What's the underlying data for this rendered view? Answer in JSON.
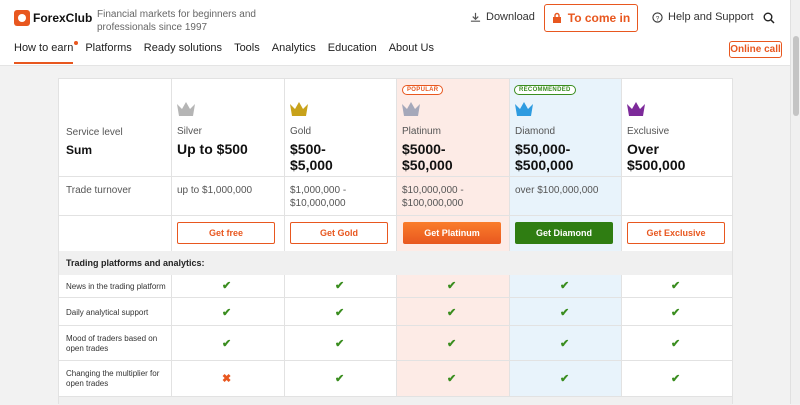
{
  "header": {
    "logo_text": "ForexClub",
    "tagline": "Financial markets for beginners and professionals since 1997",
    "download": "Download",
    "come_in": "To come in",
    "help": "Help and Support",
    "online_call": "Online call"
  },
  "nav": [
    "How to earn",
    "Platforms",
    "Ready solutions",
    "Tools",
    "Analytics",
    "Education",
    "About Us"
  ],
  "table": {
    "row_labels": {
      "service_level": "Service level",
      "sum": "Sum",
      "turnover": "Trade turnover"
    },
    "tiers": [
      {
        "name": "Silver",
        "sum": "Up to $500",
        "turnover": "up to $1,000,000",
        "button": "Get free",
        "crown_color": "#b5b5b5"
      },
      {
        "name": "Gold",
        "sum": "$500-\n$5,000",
        "turnover": "$1,000,000 -\n$10,000,000",
        "button": "Get Gold",
        "crown_color": "#c8a21a"
      },
      {
        "name": "Platinum",
        "sum": "$5000-\n$50,000",
        "turnover": "$10,000,000 -\n$100,000,000",
        "button": "Get Platinum",
        "crown_color": "#a5a8ba",
        "badge": "POPULAR"
      },
      {
        "name": "Diamond",
        "sum": "$50,000-\n$500,000",
        "turnover": "over $100,000,000",
        "button": "Get Diamond",
        "crown_color": "#2e9be0",
        "badge": "RECOMMENDED"
      },
      {
        "name": "Exclusive",
        "sum": "Over\n$500,000",
        "turnover": "",
        "button": "Get Exclusive",
        "crown_color": "#7d2a9a"
      }
    ],
    "section_title": "Trading platforms and analytics:",
    "features": [
      {
        "label": "News in the trading platform",
        "marks": [
          true,
          true,
          true,
          true,
          true
        ]
      },
      {
        "label": "Daily analytical support",
        "marks": [
          true,
          true,
          true,
          true,
          true
        ]
      },
      {
        "label": "Mood of traders based on open trades",
        "marks": [
          true,
          true,
          true,
          true,
          true
        ]
      },
      {
        "label": "Changing the multiplier for open trades",
        "marks": [
          false,
          true,
          true,
          true,
          true
        ]
      }
    ]
  }
}
